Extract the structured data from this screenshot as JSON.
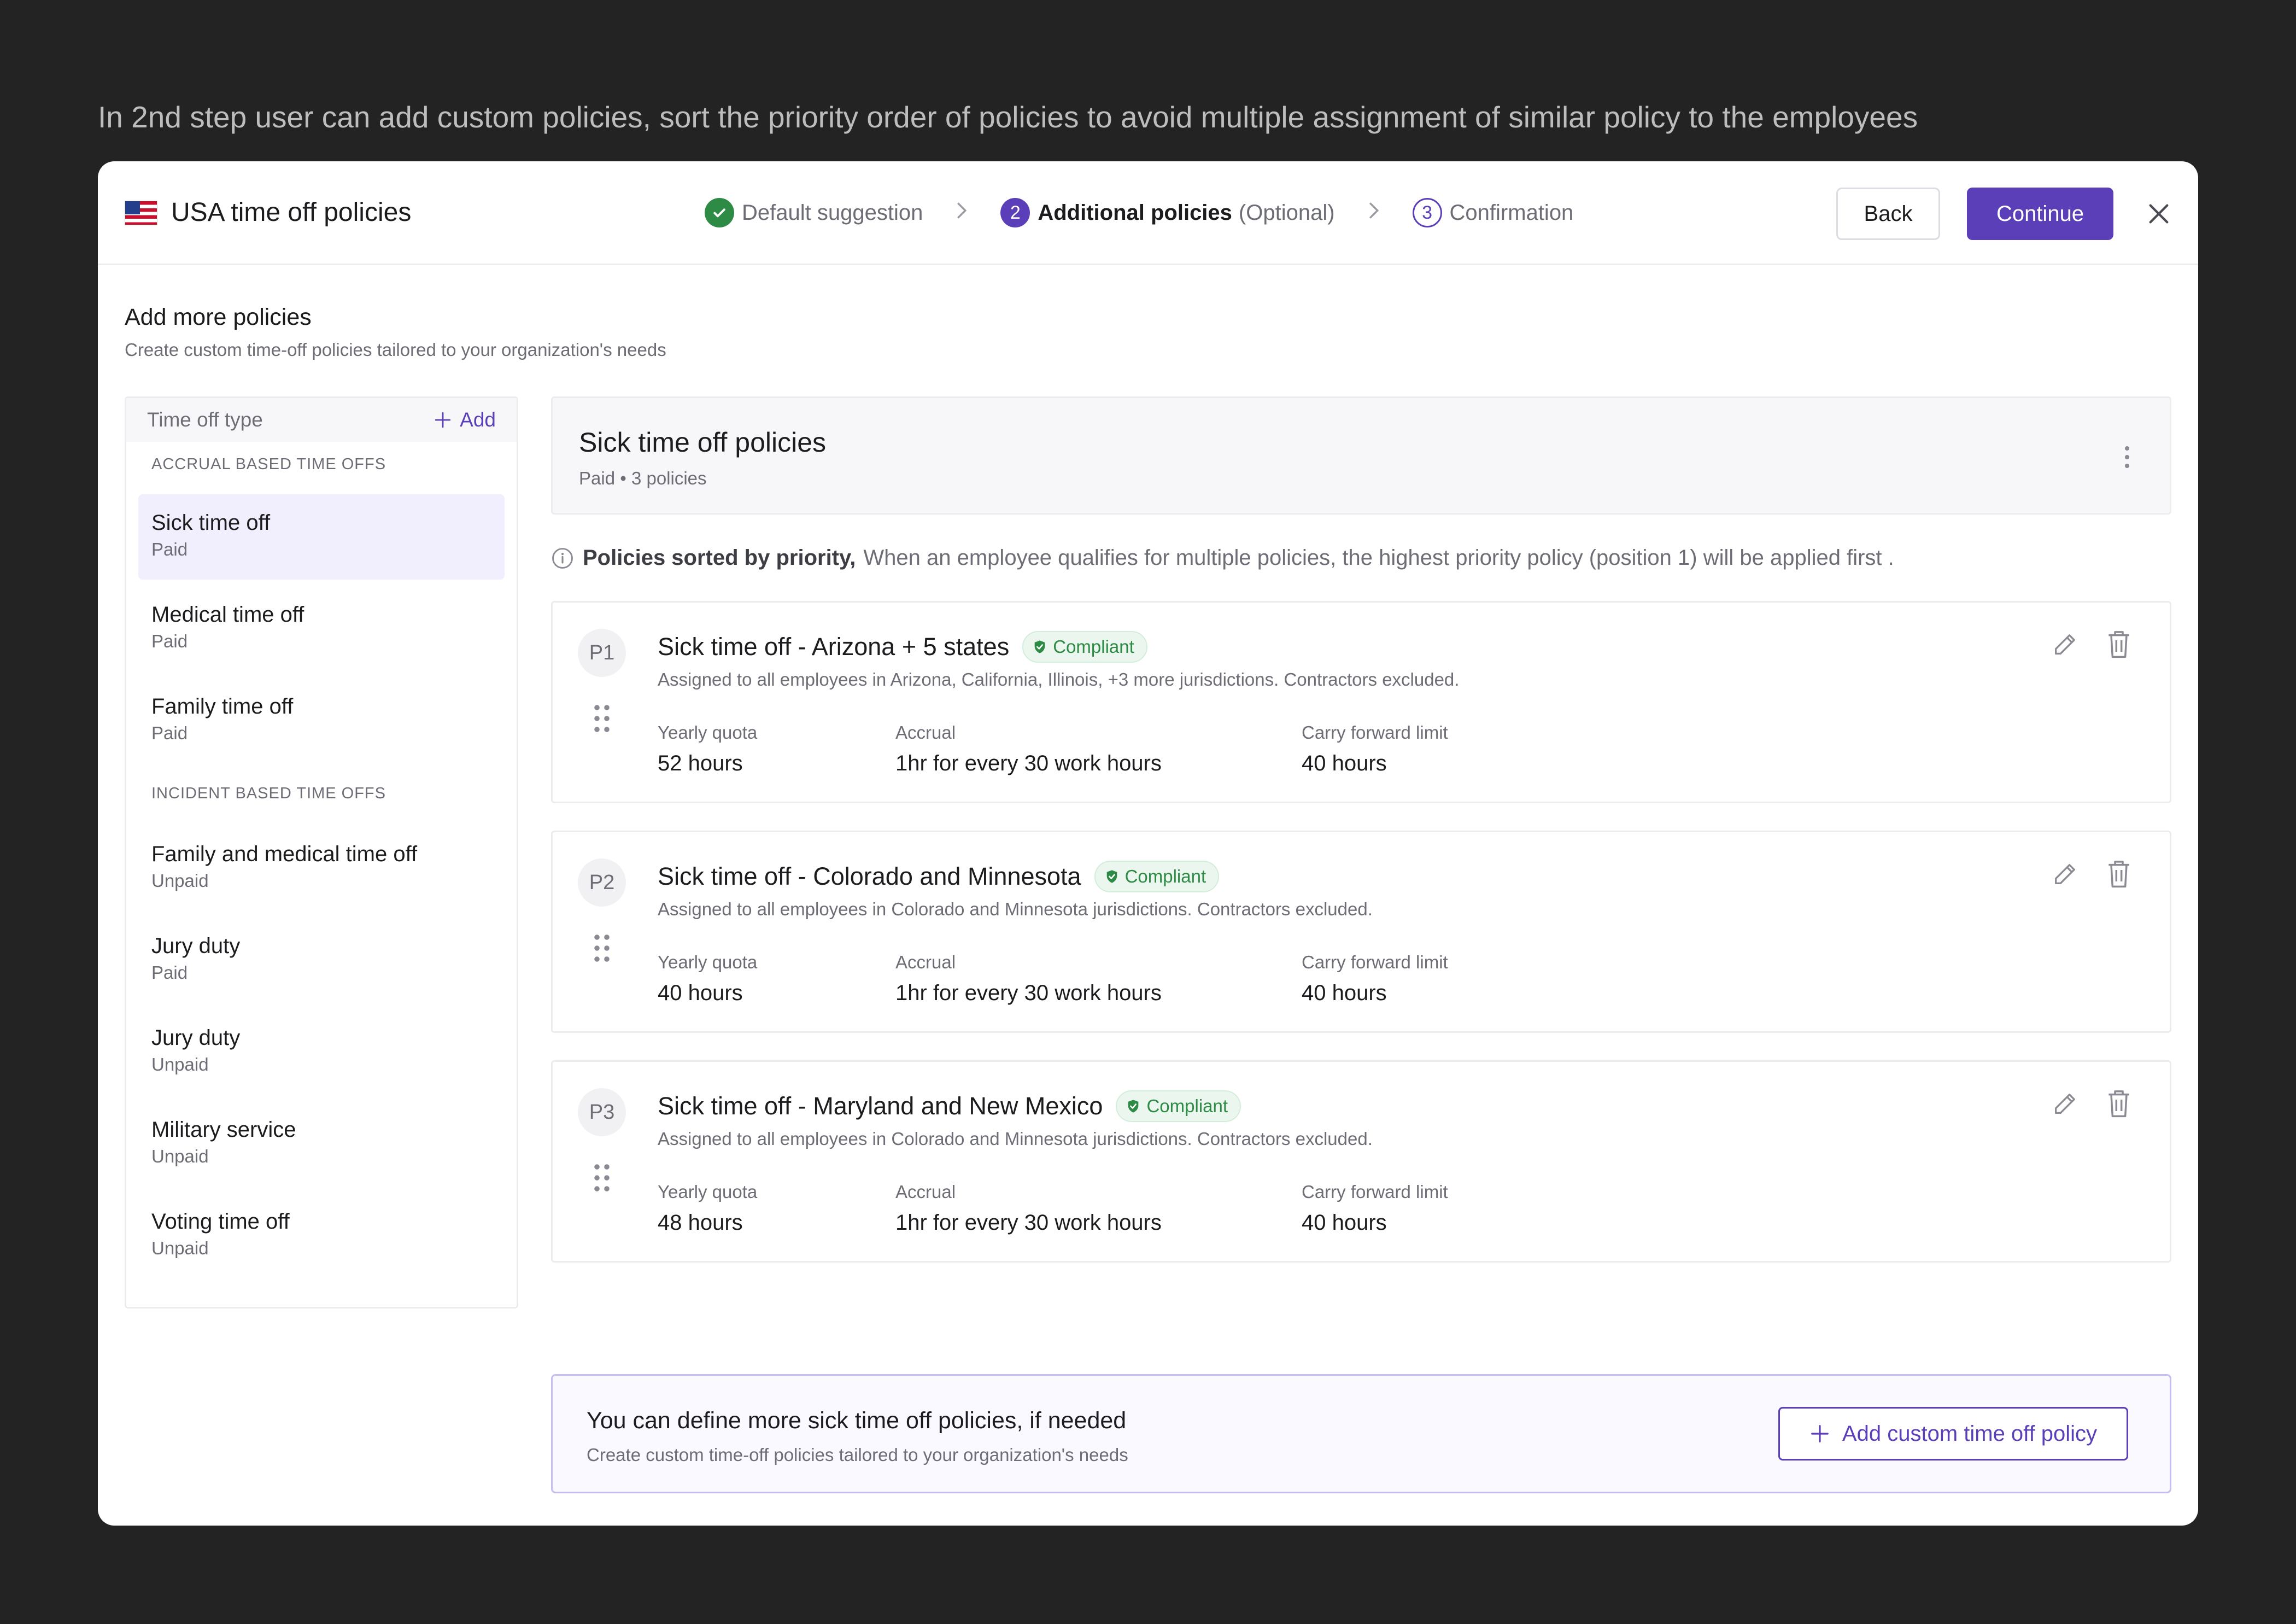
{
  "caption": "In 2nd step user can add custom policies, sort the priority order of policies to avoid multiple assignment of similar policy to the employees",
  "header": {
    "title": "USA time off policies",
    "steps": [
      {
        "label": "Default suggestion",
        "state": "done"
      },
      {
        "number": "2",
        "label": "Additional policies",
        "suffix": "(Optional)",
        "state": "active"
      },
      {
        "number": "3",
        "label": "Confirmation",
        "state": "upcoming"
      }
    ],
    "back_label": "Back",
    "continue_label": "Continue"
  },
  "section": {
    "title": "Add more policies",
    "subtitle": "Create custom time-off policies tailored to your organization's needs"
  },
  "sidebar": {
    "header_label": "Time off type",
    "add_label": "Add",
    "groups": [
      {
        "label": "ACCRUAL BASED TIME OFFS",
        "items": [
          {
            "name": "Sick time off",
            "sub": "Paid",
            "active": true
          },
          {
            "name": "Medical time off",
            "sub": "Paid"
          },
          {
            "name": "Family time off",
            "sub": "Paid"
          }
        ]
      },
      {
        "label": "INCIDENT BASED TIME OFFS",
        "items": [
          {
            "name": "Family and medical time off",
            "sub": "Unpaid"
          },
          {
            "name": "Jury duty",
            "sub": "Paid"
          },
          {
            "name": "Jury duty",
            "sub": "Unpaid"
          },
          {
            "name": "Military service",
            "sub": "Unpaid"
          },
          {
            "name": "Voting time off",
            "sub": "Unpaid"
          }
        ]
      }
    ]
  },
  "main": {
    "title": "Sick time off policies",
    "subtitle": "Paid • 3 policies",
    "info_bold": "Policies sorted by priority,",
    "info_text": "When an employee qualifies for multiple policies, the highest priority policy (position 1) will be applied first .",
    "stat_labels": {
      "quota": "Yearly quota",
      "accrual": "Accrual",
      "carry": "Carry forward limit"
    },
    "policies": [
      {
        "priority": "P1",
        "title": "Sick time off - Arizona + 5 states",
        "badge": "Compliant",
        "desc": "Assigned to all employees in Arizona, California, Illinois, +3 more jurisdictions. Contractors excluded.",
        "quota": "52 hours",
        "accrual": "1hr for every 30 work hours",
        "carry": "40 hours"
      },
      {
        "priority": "P2",
        "title": "Sick time off - Colorado and Minnesota",
        "badge": "Compliant",
        "desc": "Assigned to all employees in Colorado and Minnesota jurisdictions. Contractors excluded.",
        "quota": "40 hours",
        "accrual": "1hr for every 30 work hours",
        "carry": "40 hours"
      },
      {
        "priority": "P3",
        "title": "Sick time off - Maryland and New Mexico",
        "badge": "Compliant",
        "desc": "Assigned to all employees in Colorado and Minnesota jurisdictions. Contractors excluded.",
        "quota": "48 hours",
        "accrual": "1hr for every 30 work hours",
        "carry": "40 hours"
      }
    ]
  },
  "cta": {
    "title": "You can define more sick time off policies, if needed",
    "subtitle": "Create custom time-off policies tailored to your organization's needs",
    "button_label": "Add custom time off policy"
  },
  "colors": {
    "accent": "#5b3fb8",
    "success": "#2e8b45",
    "background": "#232323"
  }
}
